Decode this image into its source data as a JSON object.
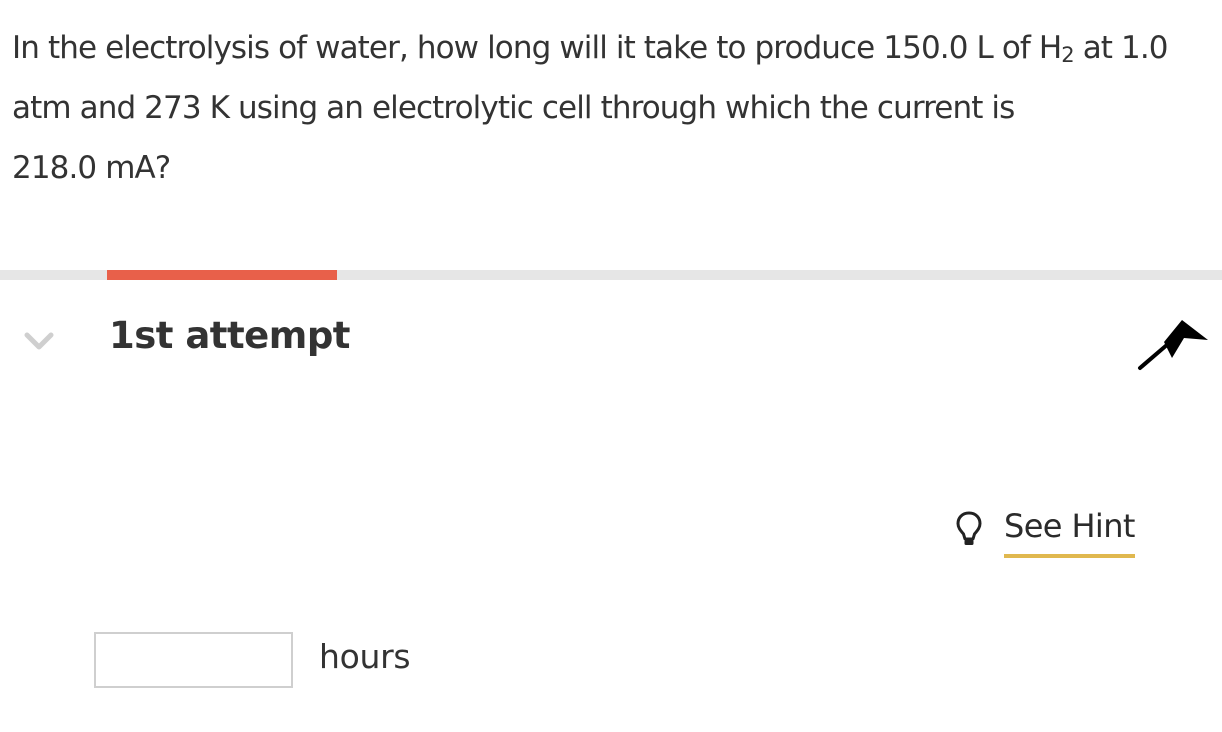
{
  "question": {
    "line1_before_sub": "In the electrolysis of water, how long will it take to produce 150.0 L of H",
    "subscript": "2",
    "line1_after_sub": " at 1.0",
    "line2": "atm and 273 K using an electrolytic cell through which the current is",
    "line3": "218.0 mA?"
  },
  "progress": {
    "segment_fraction": 0.19,
    "fill_color": "#e8604a",
    "track_color": "#e6e6e6"
  },
  "attempt": {
    "title": "1st attempt",
    "toggle_icon": "chevron-down-icon",
    "flag_icon": "flag-icon"
  },
  "hint": {
    "label": "See Hint",
    "icon": "lightbulb-icon",
    "underline_color": "#e0b84f"
  },
  "answer": {
    "value": "",
    "placeholder": "",
    "unit": "hours"
  }
}
